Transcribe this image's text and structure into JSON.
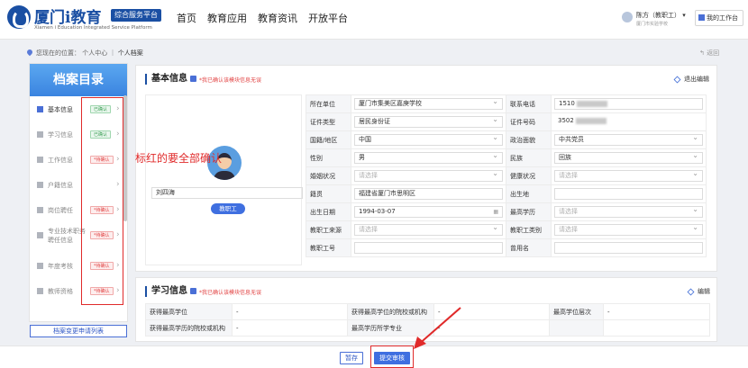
{
  "header": {
    "logo_title": "厦门i教育",
    "logo_badge": "综合服务平台",
    "logo_subtitle": "Xiamen i Education Integrated Service Platform",
    "nav": [
      "首页",
      "教育应用",
      "教育资讯",
      "开放平台"
    ],
    "user_name": "陈方（教职工）",
    "user_dropdown": "▾",
    "user_school": "厦门市实验学校",
    "workbench_label": "我的工作台"
  },
  "breadcrumb": {
    "prefix": "您现在的位置：",
    "path": [
      "个人中心",
      "个人档案"
    ],
    "back_label": "返回"
  },
  "sidebar": {
    "title": "档案目录",
    "items": [
      {
        "label": "基本信息",
        "badge": "已确认",
        "status": "ok",
        "active": true
      },
      {
        "label": "学习信息",
        "badge": "已确认",
        "status": "ok",
        "active": false
      },
      {
        "label": "工作信息",
        "badge": "*待确认",
        "status": "todo",
        "active": false
      },
      {
        "label": "户籍信息",
        "badge": "",
        "status": "none",
        "active": false
      },
      {
        "label": "岗位聘任",
        "badge": "*待确认",
        "status": "todo",
        "active": false
      },
      {
        "label": "专业技术职务聘任信息",
        "badge": "*待确认",
        "status": "todo",
        "active": false
      },
      {
        "label": "年度考核",
        "badge": "*待确认",
        "status": "todo",
        "active": false
      },
      {
        "label": "教师资格",
        "badge": "*待确认",
        "status": "todo",
        "active": false
      }
    ],
    "apply_link": "档案变更申请列表"
  },
  "basic": {
    "title": "基本信息",
    "confirm_text": "*我已确认该模块信息无误",
    "exit_edit": "退出编辑",
    "name_value": "刘四海",
    "role_button": "教职工",
    "annotation": "标红的要全部确认",
    "rows": [
      [
        {
          "k": "所在单位"
        },
        {
          "v": "厦门市集美区嘉庚学校",
          "type": "sel"
        },
        {
          "k": "联系电话"
        },
        {
          "v": "1510",
          "type": "blur"
        }
      ],
      [
        {
          "k": "证件类型"
        },
        {
          "v": "居民身份证",
          "type": "sel"
        },
        {
          "k": "证件号码"
        },
        {
          "v": "3502",
          "type": "blurplain"
        }
      ],
      [
        {
          "k": "国籍/地区"
        },
        {
          "v": "中国",
          "type": "sel"
        },
        {
          "k": "政治面貌"
        },
        {
          "v": "中共党员",
          "type": "sel"
        }
      ],
      [
        {
          "k": "性别"
        },
        {
          "v": "男",
          "type": "sel"
        },
        {
          "k": "民族"
        },
        {
          "v": "回族",
          "type": "sel"
        }
      ],
      [
        {
          "k": "婚姻状况"
        },
        {
          "v": "请选择",
          "type": "selph"
        },
        {
          "k": "健康状况"
        },
        {
          "v": "请选择",
          "type": "selph"
        }
      ],
      [
        {
          "k": "籍贯"
        },
        {
          "v": "福建省厦门市思明区",
          "type": "text"
        },
        {
          "k": "出生地"
        },
        {
          "v": "",
          "type": "text"
        }
      ],
      [
        {
          "k": "出生日期"
        },
        {
          "v": "1994-03-07",
          "type": "cal"
        },
        {
          "k": "最高学历"
        },
        {
          "v": "请选择",
          "type": "selph"
        }
      ],
      [
        {
          "k": "教职工来源"
        },
        {
          "v": "请选择",
          "type": "selph"
        },
        {
          "k": "教职工类别"
        },
        {
          "v": "请选择",
          "type": "selph"
        }
      ],
      [
        {
          "k": "教职工号"
        },
        {
          "v": "",
          "type": "text"
        },
        {
          "k": "曾用名"
        },
        {
          "v": "",
          "type": "text"
        }
      ]
    ]
  },
  "study": {
    "title": "学习信息",
    "confirm_text": "*我已确认该模块信息无误",
    "edit": "编辑",
    "rows": [
      [
        "获得最高学位",
        "-",
        "获得最高学位的院校或机构",
        "-",
        "最高学位层次",
        "-"
      ],
      [
        "获得最高学历的院校或机构",
        "-",
        "最高学历所学专业",
        "-",
        "",
        ""
      ]
    ]
  },
  "footer": {
    "save": "暂存",
    "submit": "提交审核"
  }
}
